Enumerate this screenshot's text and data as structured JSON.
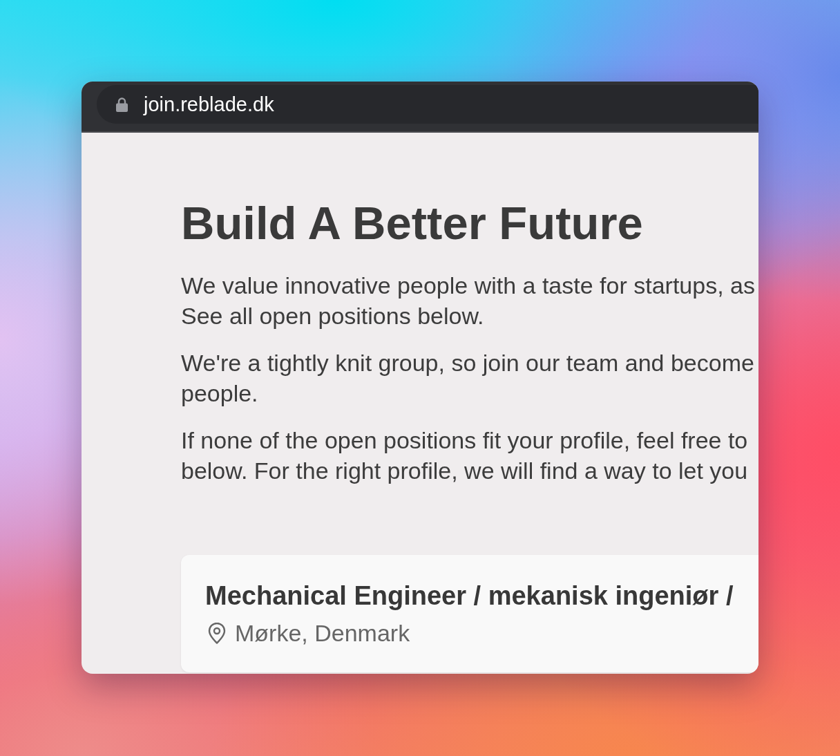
{
  "browser": {
    "url": "join.reblade.dk",
    "secure": true
  },
  "page": {
    "heading": "Build A Better Future",
    "paragraphs": [
      "We value innovative people with a taste for startups, as\nSee all open positions below.",
      "We're a tightly knit group, so join our team and become\npeople.",
      "If none of the open positions fit your profile, feel free to\nbelow. For the right profile, we will find a way to let you"
    ]
  },
  "jobs": [
    {
      "title": "Mechanical Engineer / mekanisk ingeniør /",
      "location": "Mørke, Denmark"
    }
  ]
}
